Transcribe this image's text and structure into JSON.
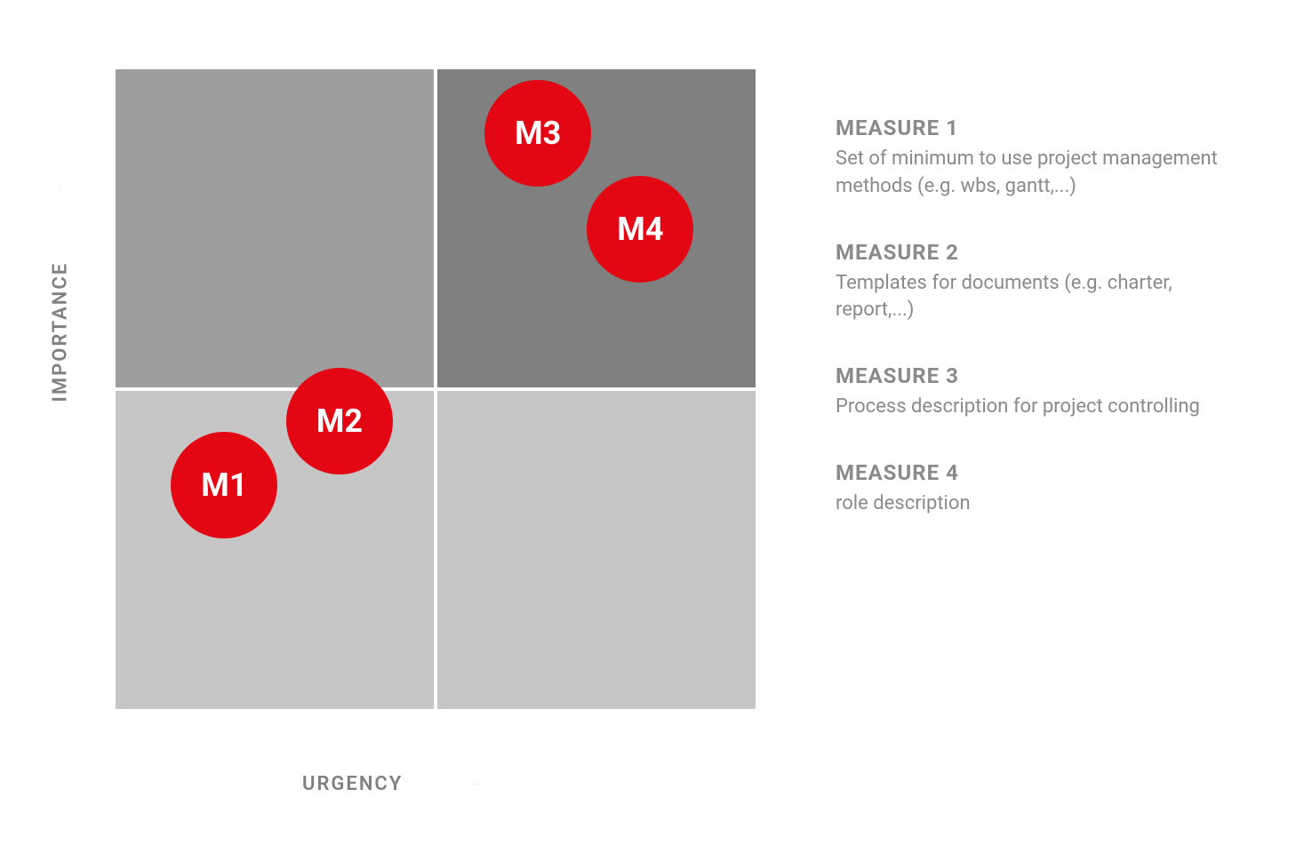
{
  "axes": {
    "x_label": "URGENCY",
    "y_label": "IMPORTANCE"
  },
  "chart_data": {
    "type": "scatter",
    "xlabel": "URGENCY",
    "ylabel": "IMPORTANCE",
    "xlim": [
      0,
      10
    ],
    "ylim": [
      0,
      10
    ],
    "quadrants": {
      "top_left": "medium",
      "top_right": "dark",
      "bottom_left": "light",
      "bottom_right": "light"
    },
    "series": [
      {
        "name": "M1",
        "x": 1.7,
        "y": 3.5
      },
      {
        "name": "M2",
        "x": 3.5,
        "y": 4.5
      },
      {
        "name": "M3",
        "x": 6.6,
        "y": 9.0
      },
      {
        "name": "M4",
        "x": 8.2,
        "y": 7.5
      }
    ]
  },
  "legend": [
    {
      "title": "MEASURE 1",
      "desc": "Set of minimum to use project management methods (e.g. wbs, gantt,...)"
    },
    {
      "title": "MEASURE 2",
      "desc": "Templates for documents (e.g. charter, report,...)"
    },
    {
      "title": "MEASURE 3",
      "desc": "Process description for project controlling"
    },
    {
      "title": "MEASURE 4",
      "desc": "role description"
    }
  ],
  "colors": {
    "bubble": "#e30613",
    "quad_tl": "#9e9e9e",
    "quad_tr": "#808080",
    "quad_bottom": "#c6c6c6",
    "text_muted": "#8a8a8a"
  }
}
